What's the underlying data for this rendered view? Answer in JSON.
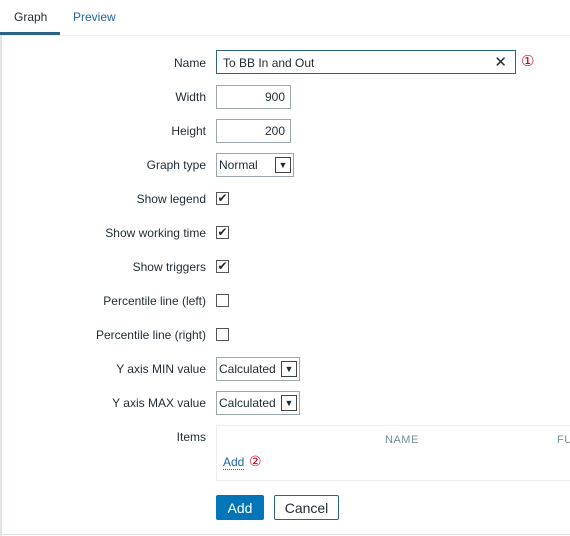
{
  "tabs": [
    {
      "label": "Graph",
      "active": true
    },
    {
      "label": "Preview",
      "active": false
    }
  ],
  "form": {
    "name": {
      "label": "Name",
      "value": "To BB In and Out",
      "marker": "①"
    },
    "width": {
      "label": "Width",
      "value": "900"
    },
    "height": {
      "label": "Height",
      "value": "200"
    },
    "graph_type": {
      "label": "Graph type",
      "value": "Normal"
    },
    "show_legend": {
      "label": "Show legend",
      "checked": true
    },
    "show_working_time": {
      "label": "Show working time",
      "checked": true
    },
    "show_triggers": {
      "label": "Show triggers",
      "checked": true
    },
    "percentile_left": {
      "label": "Percentile line (left)",
      "checked": false
    },
    "percentile_right": {
      "label": "Percentile line (right)",
      "checked": false
    },
    "ymin": {
      "label": "Y axis MIN value",
      "value": "Calculated"
    },
    "ymax": {
      "label": "Y axis MAX value",
      "value": "Calculated"
    },
    "items": {
      "label": "Items",
      "columns": [
        "NAME",
        "FU"
      ],
      "add_label": "Add",
      "marker": "②"
    }
  },
  "buttons": {
    "add": "Add",
    "cancel": "Cancel"
  },
  "colors": {
    "primary": "#0275b8",
    "link": "#1f65a6",
    "marker": "#d0021b"
  }
}
